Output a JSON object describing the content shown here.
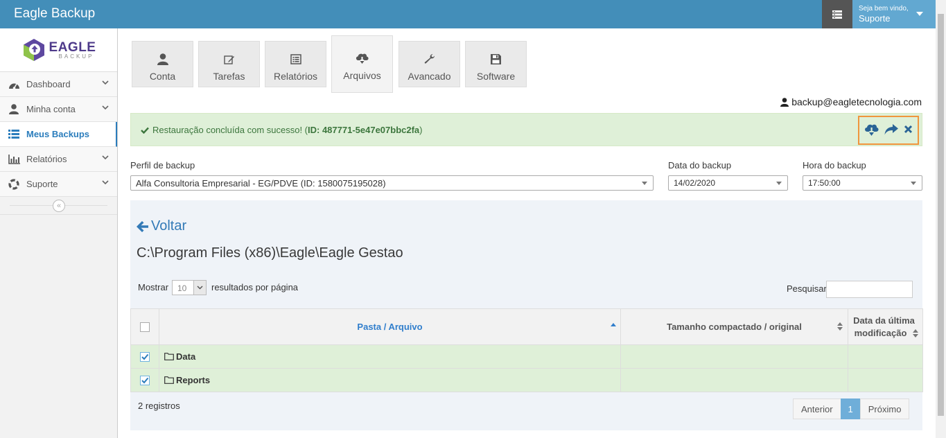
{
  "app": {
    "title": "Eagle Backup"
  },
  "header": {
    "welcome": "Seja bem vindo,",
    "user_name": "Suporte"
  },
  "logo": {
    "brand": "EAGLE",
    "sub": "BACKUP"
  },
  "sidebar": {
    "items": [
      {
        "label": "Dashboard",
        "icon": "tachometer-icon"
      },
      {
        "label": "Minha conta",
        "icon": "user-icon"
      },
      {
        "label": "Meus Backups",
        "icon": "list-icon",
        "active": true
      },
      {
        "label": "Relatórios",
        "icon": "bar-chart-icon"
      },
      {
        "label": "Suporte",
        "icon": "life-ring-icon"
      }
    ],
    "collapse_icon": "double-angle-left-icon"
  },
  "tabs": [
    {
      "label": "Conta",
      "icon": "user-icon"
    },
    {
      "label": "Tarefas",
      "icon": "edit-icon"
    },
    {
      "label": "Relatórios",
      "icon": "list-alt-icon"
    },
    {
      "label": "Arquivos",
      "icon": "cloud-download-icon",
      "active": true
    },
    {
      "label": "Avancado",
      "icon": "wrench-icon"
    },
    {
      "label": "Software",
      "icon": "floppy-icon"
    }
  ],
  "account": {
    "email": "backup@eagletecnologia.com"
  },
  "alert": {
    "message": "Restauração concluída com sucesso! (",
    "id_text": "ID: 487771-5e47e07bbc2fa",
    "closing": ")",
    "actions": [
      "cloud-download-icon",
      "share-icon",
      "close-icon"
    ]
  },
  "form": {
    "profile_label": "Perfil de backup",
    "profile_value": "Alfa Consultoria Empresarial - EG/PDVE (ID: 1580075195028)",
    "date_label": "Data do backup",
    "date_value": "14/02/2020",
    "time_label": "Hora do backup",
    "time_value": "17:50:00"
  },
  "browser": {
    "back_label": "Voltar",
    "path": "C:\\Program Files (x86)\\Eagle\\Eagle Gestao",
    "show_label": "Mostrar",
    "page_size": "10",
    "per_page_label": "resultados por página",
    "search_label": "Pesquisar",
    "search_value": "",
    "columns": {
      "name": "Pasta / Arquivo",
      "size": "Tamanho compactado / original",
      "modified_line1": "Data da última",
      "modified_line2": "modificação"
    },
    "rows": [
      {
        "name": "Data",
        "size": "",
        "modified": "",
        "checked": true
      },
      {
        "name": "Reports",
        "size": "",
        "modified": "",
        "checked": true
      }
    ],
    "records_text": "2 registros",
    "pager": {
      "prev": "Anterior",
      "current": "1",
      "next": "Próximo"
    }
  },
  "colors": {
    "header_bg": "#438eb9",
    "user_bg": "#62a8d1",
    "alert_bg": "#dff0d8",
    "alert_text": "#3c763d",
    "highlight_border": "#f0953d",
    "link": "#337ab7",
    "active_nav": "#2b7dbc"
  }
}
